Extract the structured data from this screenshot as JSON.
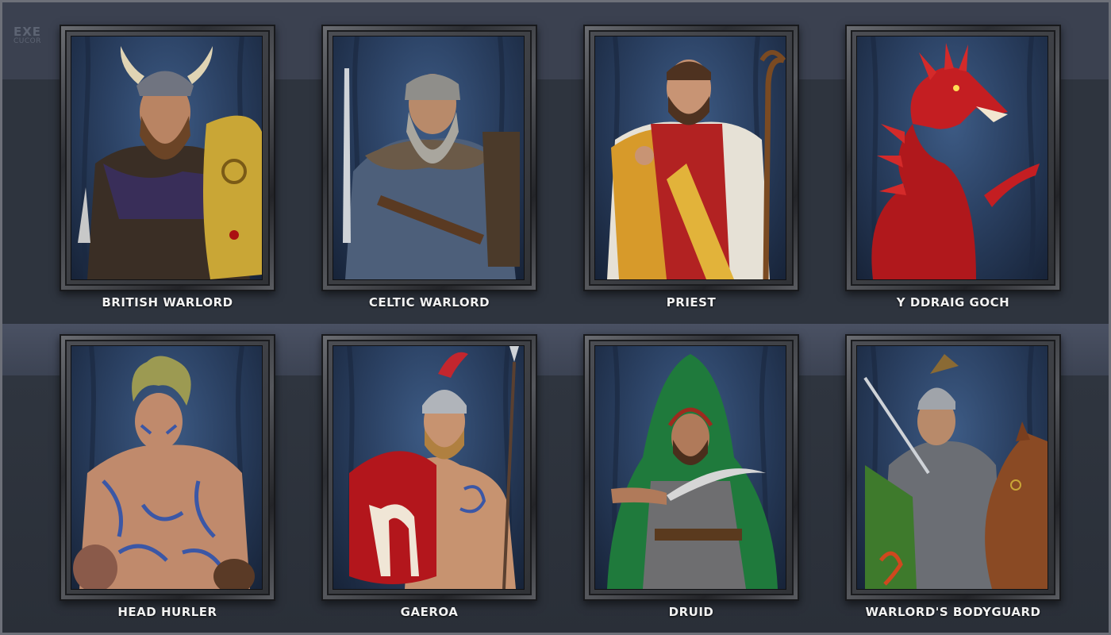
{
  "watermark": {
    "line1": "EXE",
    "line2": "CUCOR"
  },
  "units": [
    {
      "name": "BRITISH WARLORD"
    },
    {
      "name": "CELTIC WARLORD"
    },
    {
      "name": "PRIEST"
    },
    {
      "name": "Y DDRAIG GOCH"
    },
    {
      "name": "HEAD HURLER"
    },
    {
      "name": "GAEROA"
    },
    {
      "name": "DRUID"
    },
    {
      "name": "WARLORD'S BODYGUARD"
    }
  ],
  "colors": {
    "background": "#2b3038",
    "label": "#f2f2f2",
    "forest": "#2b4163"
  }
}
